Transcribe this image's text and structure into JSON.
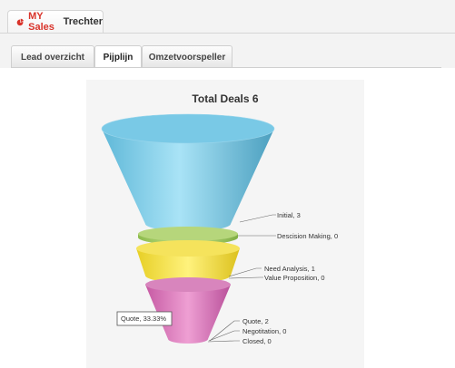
{
  "header": {
    "brand": "MY Sales",
    "title": "Trechter"
  },
  "tabs": [
    {
      "label": "Lead overzicht"
    },
    {
      "label": "Pijplijn"
    },
    {
      "label": "Omzetvoorspeller"
    }
  ],
  "chart_data": {
    "type": "funnel",
    "title": "Total Deals 6",
    "stages": [
      {
        "name": "Initial",
        "value": 3,
        "label": "Initial, 3",
        "color": "#7dcde9"
      },
      {
        "name": "Descision Making",
        "value": 0,
        "label": "Descision Making, 0",
        "color": "#a8cc6a"
      },
      {
        "name": "Need Analysis",
        "value": 1,
        "label": "Need Analysis, 1",
        "color": "#f0dd4a"
      },
      {
        "name": "Value Proposition",
        "value": 0,
        "label": "Value Proposition, 0",
        "color": "#f0dd4a"
      },
      {
        "name": "Quote",
        "value": 2,
        "label": "Quote, 2",
        "color": "#d67fb8"
      },
      {
        "name": "Negotitation",
        "value": 0,
        "label": "Negotitation, 0",
        "color": "#d67fb8"
      },
      {
        "name": "Closed",
        "value": 0,
        "label": "Closed, 0",
        "color": "#d67fb8"
      }
    ],
    "tooltip": "Quote, 33.33%"
  }
}
